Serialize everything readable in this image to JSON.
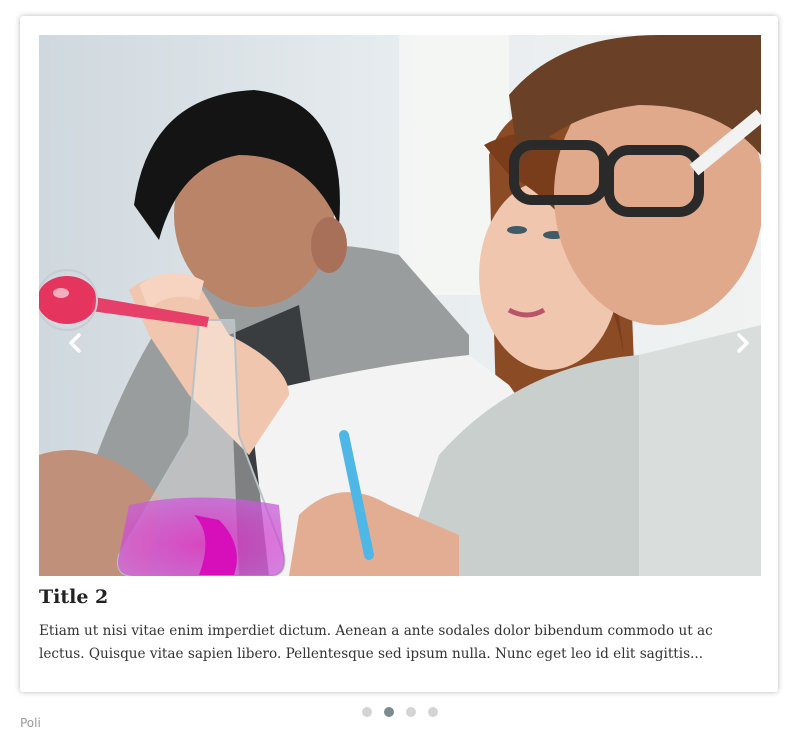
{
  "slider": {
    "title": "Title 2",
    "description": "Etiam ut nisi vitae enim imperdiet dictum. Aenean a ante sodales dolor bibendum commodo ut ac lectus. Quisque vitae sapien libero. Pellentesque sed ipsum nulla. Nunc eget leo id elit sagittis...",
    "image_alt": "Students in a chemistry lab pouring pink liquid into a flask",
    "prev_icon": "chevron-left-icon",
    "next_icon": "chevron-right-icon",
    "dots": [
      {
        "active": false
      },
      {
        "active": true
      },
      {
        "active": false
      },
      {
        "active": false
      }
    ],
    "active_dot_color": "#7b8b8e",
    "inactive_dot_color": "#d4d4d4"
  },
  "below": {
    "partial_text": "Poli"
  }
}
